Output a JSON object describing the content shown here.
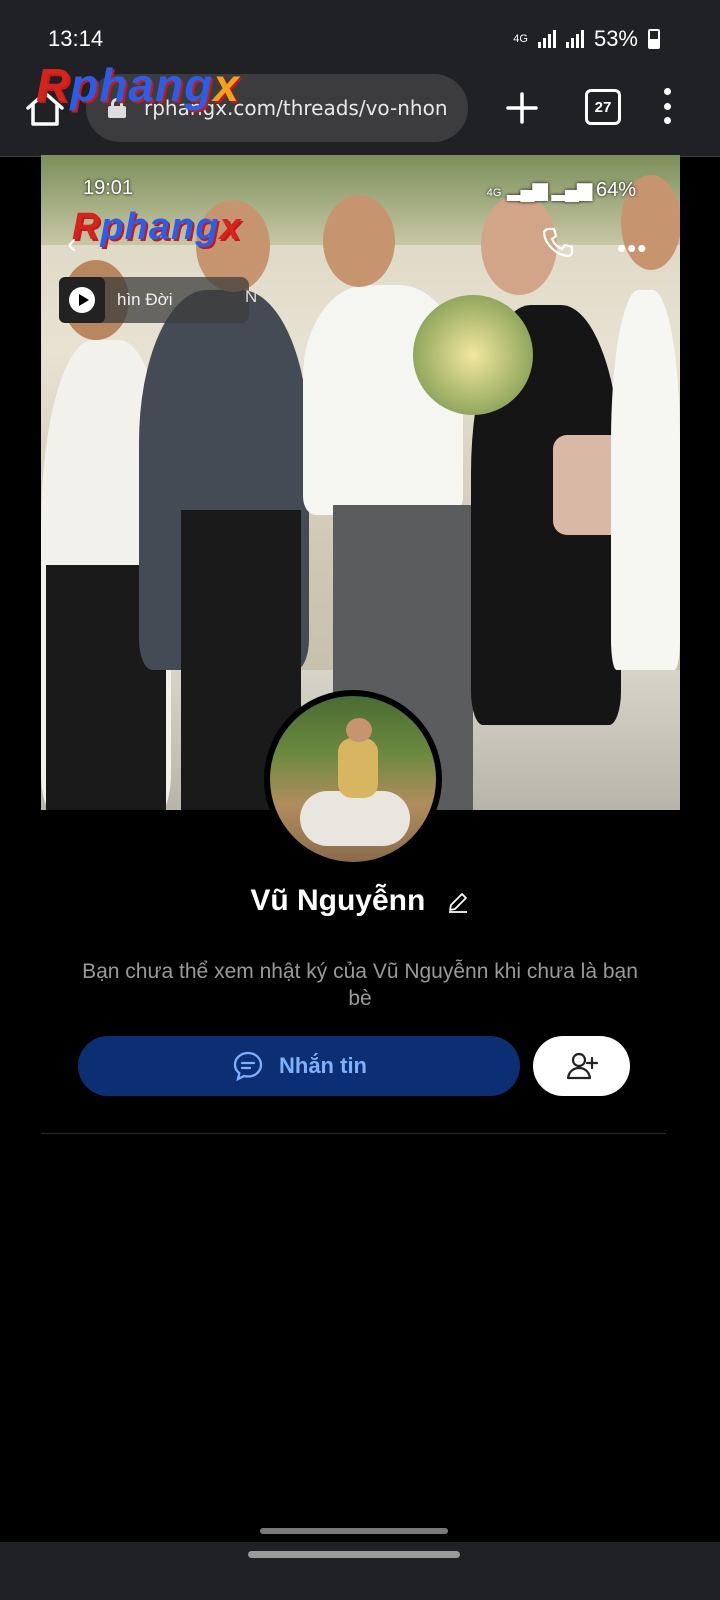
{
  "status_bar": {
    "time": "13:14",
    "network": "4G",
    "battery": "53%"
  },
  "browser": {
    "url": "rphangx.com/threads/vo-nhon",
    "tab_count": "27"
  },
  "watermark": {
    "part1": "Rphang",
    "part2": "X"
  },
  "inner_screen": {
    "time": "19:01",
    "network": "4G",
    "battery": "64%",
    "music_title": "hìn Đời",
    "music_more": "N"
  },
  "profile": {
    "name": "Vũ Nguyễnn",
    "notice": "Bạn chưa thể xem nhật ký của Vũ Nguyễnn khi chưa là bạn bè",
    "message_button": "Nhắn tin"
  },
  "colors": {
    "accent": "#0c2f73",
    "accent_text": "#7fb0ff"
  }
}
